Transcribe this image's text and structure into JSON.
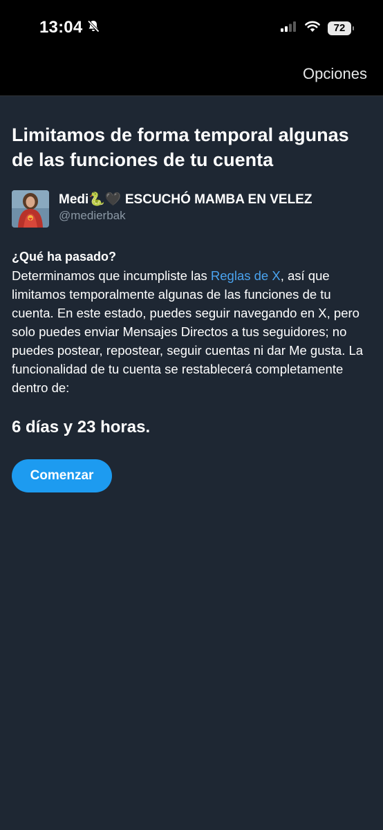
{
  "status_bar": {
    "time": "13:04",
    "battery": "72",
    "icons": [
      "bell-slash-icon",
      "signal-icon",
      "wifi-icon",
      "battery-icon"
    ]
  },
  "nav": {
    "options_label": "Opciones"
  },
  "main": {
    "title": "Limitamos de forma temporal algunas de las funciones de tu cuenta",
    "account": {
      "display_name": "Medi🐍🖤 ESCUCHÓ MAMBA EN VELEZ",
      "handle": "@medierbak"
    },
    "section_heading": "¿Qué ha pasado?",
    "body": {
      "before_link": "Determinamos que incumpliste las ",
      "link_text": "Reglas de X",
      "after_link": ", así que limitamos temporalmente algunas de las funciones de tu cuenta. En este estado, puedes seguir navegando en X, pero solo puedes enviar Mensajes Directos a tus seguidores; no puedes postear, repostear, seguir cuentas ni dar Me gusta. La funcionalidad de tu cuenta se restablecerá completamente dentro de:"
    },
    "countdown": "6 días y 23 horas.",
    "start_button_label": "Comenzar"
  },
  "colors": {
    "background": "#1e2733",
    "link": "#4aa3ef",
    "button": "#1d9bf0",
    "secondary_text": "#8b98a5"
  }
}
